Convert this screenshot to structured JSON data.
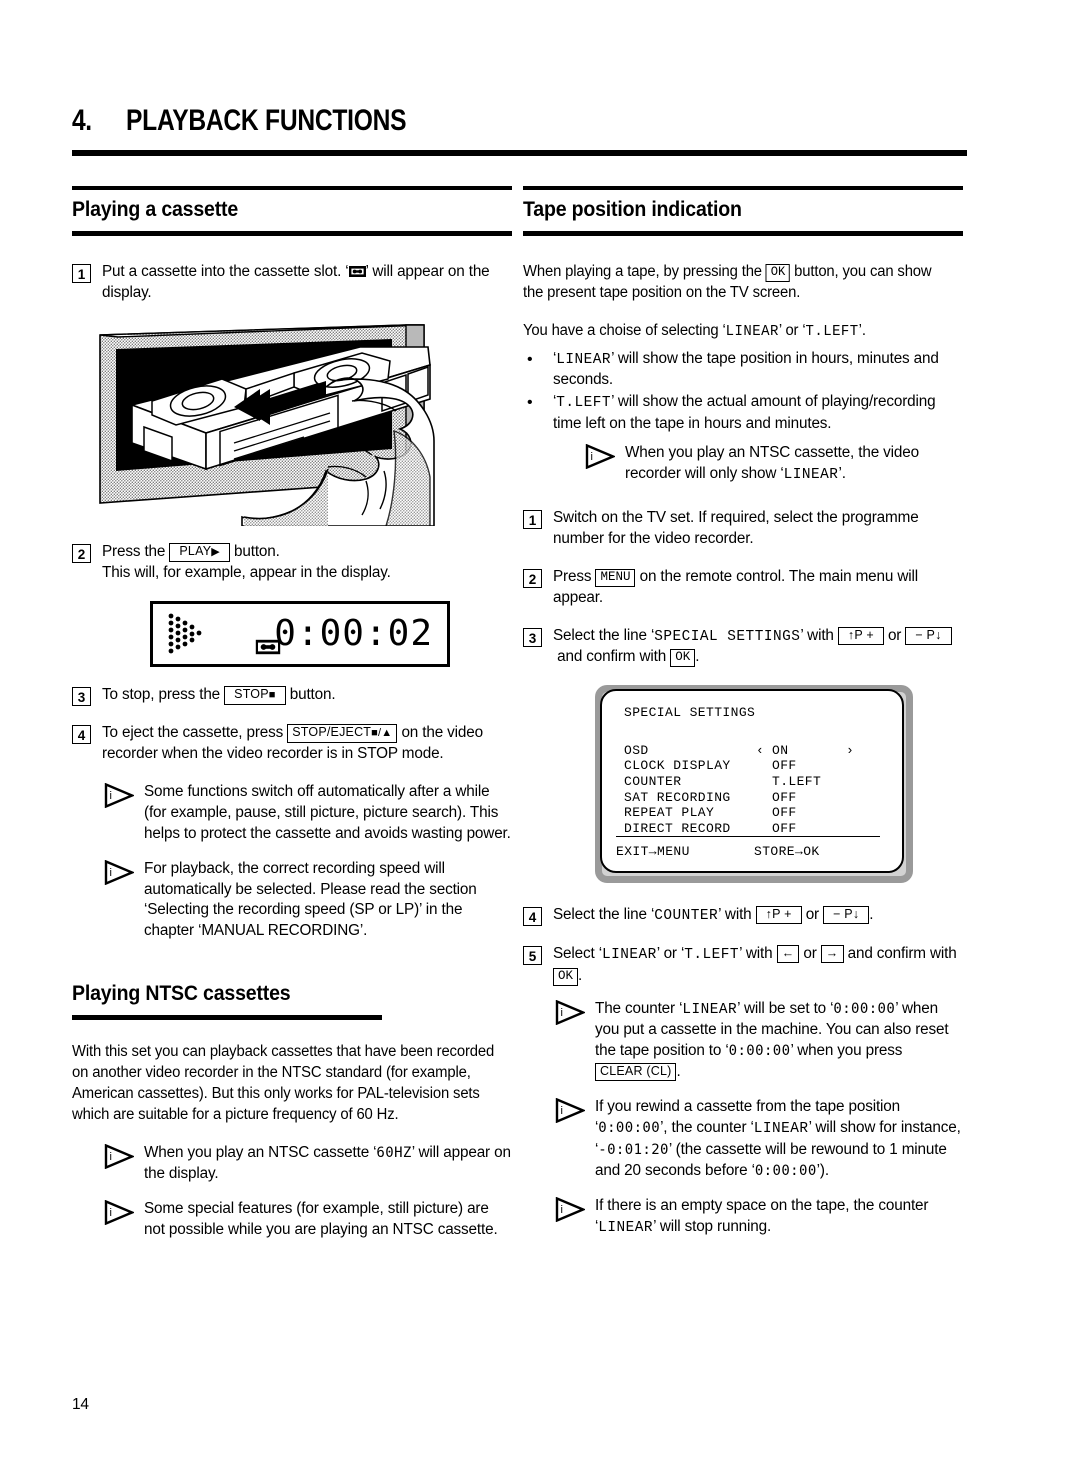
{
  "chapter": {
    "number": "4.",
    "title": "PLAYBACK FUNCTIONS"
  },
  "page_number": "14",
  "left_column": {
    "section1": {
      "title": "Playing a cassette",
      "step1": {
        "num": "1",
        "text_before": "Put a cassette into the cassette slot. ‘",
        "icon": "cassette-icon",
        "text_after": "’ will appear on the display."
      },
      "figure_insert": {
        "name": "cassette-insertion-illustration",
        "caption": ""
      },
      "step2": {
        "num": "2",
        "text_before": "Press the",
        "key": "PLAY",
        "key_glyph": "▶",
        "text_after": "button.",
        "line2": "This will, for example, appear in the display."
      },
      "figure_display": {
        "name": "vfd-display",
        "play_indicator": "play-arrow-dotmatrix",
        "cassette_indicator": "cassette-icon",
        "time": "0:00:02"
      },
      "step3": {
        "num": "3",
        "text_before": "To stop, press the",
        "key": "STOP",
        "key_glyph": "■",
        "text_after": "button."
      },
      "step4": {
        "num": "4",
        "text_before": "To eject the cassette, press",
        "key": "STOP/EJECT",
        "key_glyph": "■/▲",
        "text_after": "on the video recorder when the video recorder is in STOP mode."
      },
      "note1": "Some functions switch off automatically after a while (for example, pause, still picture, picture search). This helps to protect the cassette and avoids wasting power.",
      "note2": "For playback, the correct recording speed will automatically be selected. Please read the section ‘Selecting the recording speed (SP or LP)’ in the chapter ‘MANUAL RECORDING’."
    },
    "section2": {
      "title": "Playing NTSC cassettes",
      "para": "With this set you can playback cassettes that have been recorded on another video recorder in the NTSC standard (for example, American cassettes). But this only works for PAL-television sets which are suitable for a picture frequency of 60 Hz.",
      "note1_before": "When you play an NTSC cassette ‘",
      "note1_seg": "60HZ",
      "note1_after": "’ will appear on the display.",
      "note2": "Some special features (for example, still picture) are not possible while you are playing an NTSC cassette."
    }
  },
  "right_column": {
    "section": {
      "title": "Tape position indication",
      "para1_before": "When playing a tape, by pressing the",
      "para1_key": "OK",
      "para1_after": "button, you can show the present tape position on the TV screen.",
      "para2_before": "You have a choise of selecting ‘",
      "para2_opt1": "LINEAR",
      "para2_mid": "’ or ‘",
      "para2_opt2": "T.LEFT",
      "para2_after": "’.",
      "bullet1_opt": "LINEAR",
      "bullet1_text": "’ will show the tape position in hours, minutes and seconds.",
      "bullet2_opt": "T.LEFT",
      "bullet2_text": "’ will show the actual amount of playing/recording time left on the tape in hours and minutes.",
      "note_ntsc_before": "When you play an NTSC cassette, the video recorder will only show ‘",
      "note_ntsc_opt": "LINEAR",
      "note_ntsc_after": "’.",
      "step1": {
        "num": "1",
        "text": "Switch on the TV set. If required, select the programme number for the video recorder."
      },
      "step2": {
        "num": "2",
        "text_before": "Press",
        "key": "MENU",
        "text_after": "on the remote control. The main menu will appear."
      },
      "step3": {
        "num": "3",
        "text_before": "Select the line ‘",
        "menu_item": "SPECIAL SETTINGS",
        "text_mid1": "’ with",
        "key_up": "↑P +",
        "text_mid2": "or",
        "key_down": "− P↓",
        "text_mid3": "and confirm with",
        "key_ok": "OK",
        "text_after": "."
      },
      "step4": {
        "num": "4",
        "text_before": "Select the line ‘",
        "menu_item": "COUNTER",
        "text_mid1": "’ with",
        "key_up": "↑P +",
        "text_mid2": "or",
        "key_down": "− P↓",
        "text_after": "."
      },
      "step5": {
        "num": "5",
        "text_before": "Select ‘",
        "opt1": "LINEAR",
        "text_mid0": "’ or ‘",
        "opt2": "T.LEFT",
        "text_mid1": "’ with",
        "key_left": "←",
        "text_mid2": "or",
        "key_right": "→",
        "text_mid3": "and confirm with",
        "key_ok": "OK",
        "text_after": "."
      },
      "note_counter": {
        "t1": "The counter ‘",
        "opt": "LINEAR",
        "t2": "’ will be set to ‘",
        "seg1": "0:00:00",
        "t3": "’ when you put a cassette in the machine. You can also reset the tape position to ‘",
        "seg2": "0:00:00",
        "t4": "’ when you press",
        "key": "CLEAR (CL)",
        "t5": "."
      },
      "note_rewind": {
        "t1": "If you rewind a cassette from the tape position ‘",
        "seg1": "0:00:00",
        "t2": "’, the counter ‘",
        "opt": "LINEAR",
        "t3": "’ will show for instance, ‘",
        "seg2": "-0:01:20",
        "t4": "’ (the cassette will be rewound to 1 minute and 20 seconds before ‘",
        "seg3": "0:00:00",
        "t5": "’)."
      },
      "note_empty": {
        "t1": "If there is an empty space on the tape, the counter ‘",
        "opt": "LINEAR",
        "t2": "’ will stop running."
      }
    },
    "tv_menu": {
      "title": "SPECIAL SETTINGS",
      "left_arrow": "‹",
      "right_arrow": "›",
      "rows": [
        {
          "label": "OSD",
          "value": "ON",
          "arrows": true
        },
        {
          "label": "CLOCK DISPLAY",
          "value": "OFF",
          "arrows": false
        },
        {
          "label": "COUNTER",
          "value": "T.LEFT",
          "arrows": false
        },
        {
          "label": "SAT RECORDING",
          "value": "OFF",
          "arrows": false
        },
        {
          "label": "REPEAT PLAY",
          "value": "OFF",
          "arrows": false
        },
        {
          "label": "DIRECT RECORD",
          "value": "OFF",
          "arrows": false
        }
      ],
      "footer_left": "EXIT→MENU",
      "footer_right": "STORE→OK"
    }
  }
}
